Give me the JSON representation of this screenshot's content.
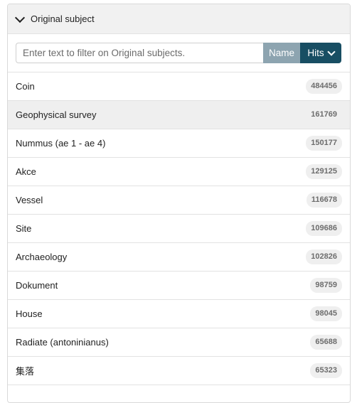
{
  "facet": {
    "title": "Original subject",
    "chevron_icon": "chevron-down-icon"
  },
  "filter": {
    "placeholder": "Enter text to filter on Original subjects.",
    "value": "",
    "sort_name_label": "Name",
    "sort_hits_label": "Hits",
    "active_sort": "Hits"
  },
  "items": [
    {
      "label": "Coin",
      "count": "484456",
      "active": false
    },
    {
      "label": "Geophysical survey",
      "count": "161769",
      "active": true
    },
    {
      "label": "Nummus (ae 1 - ae 4)",
      "count": "150177",
      "active": false
    },
    {
      "label": "Akce",
      "count": "129125",
      "active": false
    },
    {
      "label": "Vessel",
      "count": "116678",
      "active": false
    },
    {
      "label": "Site",
      "count": "109686",
      "active": false
    },
    {
      "label": "Archaeology",
      "count": "102826",
      "active": false
    },
    {
      "label": "Dokument",
      "count": "98759",
      "active": false
    },
    {
      "label": "House",
      "count": "98045",
      "active": false
    },
    {
      "label": "Radiate (antoninianus)",
      "count": "65688",
      "active": false
    },
    {
      "label": "集落",
      "count": "65323",
      "active": false
    }
  ],
  "colors": {
    "hits_button": "#184e63",
    "name_button": "#8da4b0",
    "header_bg": "#f1f1f1",
    "active_row_bg": "#efefef"
  }
}
